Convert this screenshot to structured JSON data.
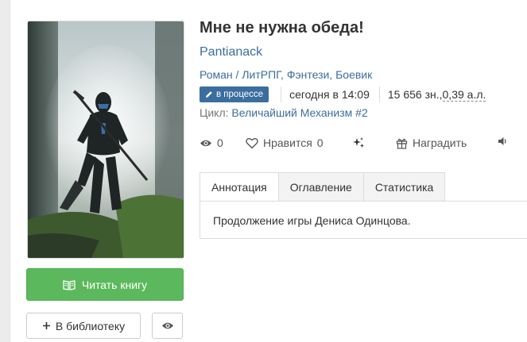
{
  "book": {
    "title": "Мне не нужна обеда!",
    "author": "Pantianack",
    "genres": [
      "Роман",
      "ЛитРПГ",
      "Фэнтези",
      "Боевик"
    ],
    "genre_sep_1": " / ",
    "genre_sep_2": ", ",
    "genre_sep_3": ", ",
    "status_badge": "в процессе",
    "updated": "сегодня в 14:09",
    "size_chars": "15 656 зн., ",
    "size_al": "0,39 а.л.",
    "cycle_label": "Цикл:",
    "cycle_name": "Величайший Механизм",
    "cycle_num": "#2"
  },
  "actions": {
    "views": "0",
    "likes_label": "Нравится",
    "likes": "0",
    "reward_label": "Наградить"
  },
  "buttons": {
    "read": "Читать книгу",
    "library": "В библиотеку"
  },
  "tabs": [
    {
      "label": "Аннотация",
      "active": true
    },
    {
      "label": "Оглавление",
      "active": false
    },
    {
      "label": "Статистика",
      "active": false
    }
  ],
  "annotation": "Продолжение игры Дениса Одинцова.",
  "icons": {
    "badge": "pencil-icon",
    "views": "eye-icon",
    "likes": "heart-icon",
    "sparkle": "sparkles-icon",
    "reward": "gift-icon",
    "audio": "speaker-icon",
    "read": "open-book-icon",
    "library": "plus-icon",
    "watch": "eye-icon"
  },
  "colors": {
    "link": "#3b6e9f",
    "read_button": "#5cb85c",
    "badge": "#3b6e9f"
  }
}
